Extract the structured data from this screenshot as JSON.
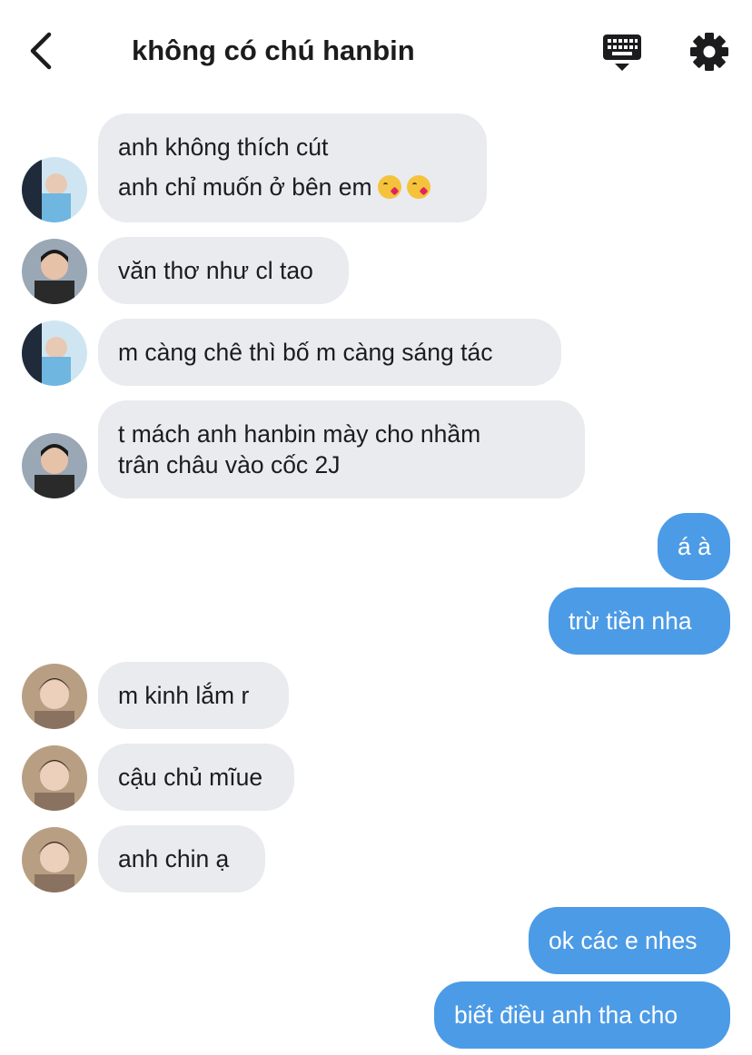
{
  "header": {
    "title": "không có chú hanbin",
    "back_icon": "chevron-left-icon",
    "keyboard_icon": "keyboard-hide-icon",
    "settings_icon": "gear-icon"
  },
  "colors": {
    "incoming_bubble": "#e9ebef",
    "outgoing_bubble": "#4c9be6",
    "outgoing_text": "#ffffff",
    "text": "#1c1c1e"
  },
  "messages": [
    {
      "side": "in",
      "lines": [
        "anh không thích cút",
        "anh chỉ muốn ở bên em"
      ],
      "emoji": "kissing-heart-emoji"
    },
    {
      "side": "in",
      "lines": [
        "văn thơ như cl tao"
      ]
    },
    {
      "side": "in",
      "lines": [
        "m càng chê thì bố m càng sáng tác"
      ]
    },
    {
      "side": "in",
      "lines": [
        "t mách anh hanbin mày cho nhầm",
        "trân châu vào cốc 2J"
      ]
    },
    {
      "side": "out",
      "lines": [
        "á à"
      ]
    },
    {
      "side": "out",
      "lines": [
        "trừ tiền nha"
      ]
    },
    {
      "side": "in",
      "lines": [
        "m kinh lắm r"
      ]
    },
    {
      "side": "in",
      "lines": [
        "cậu chủ mĩue"
      ]
    },
    {
      "side": "in",
      "lines": [
        "anh chin ạ"
      ]
    },
    {
      "side": "out",
      "lines": [
        "ok các e nhes"
      ]
    },
    {
      "side": "out",
      "lines": [
        "biết điều anh tha cho"
      ]
    }
  ]
}
